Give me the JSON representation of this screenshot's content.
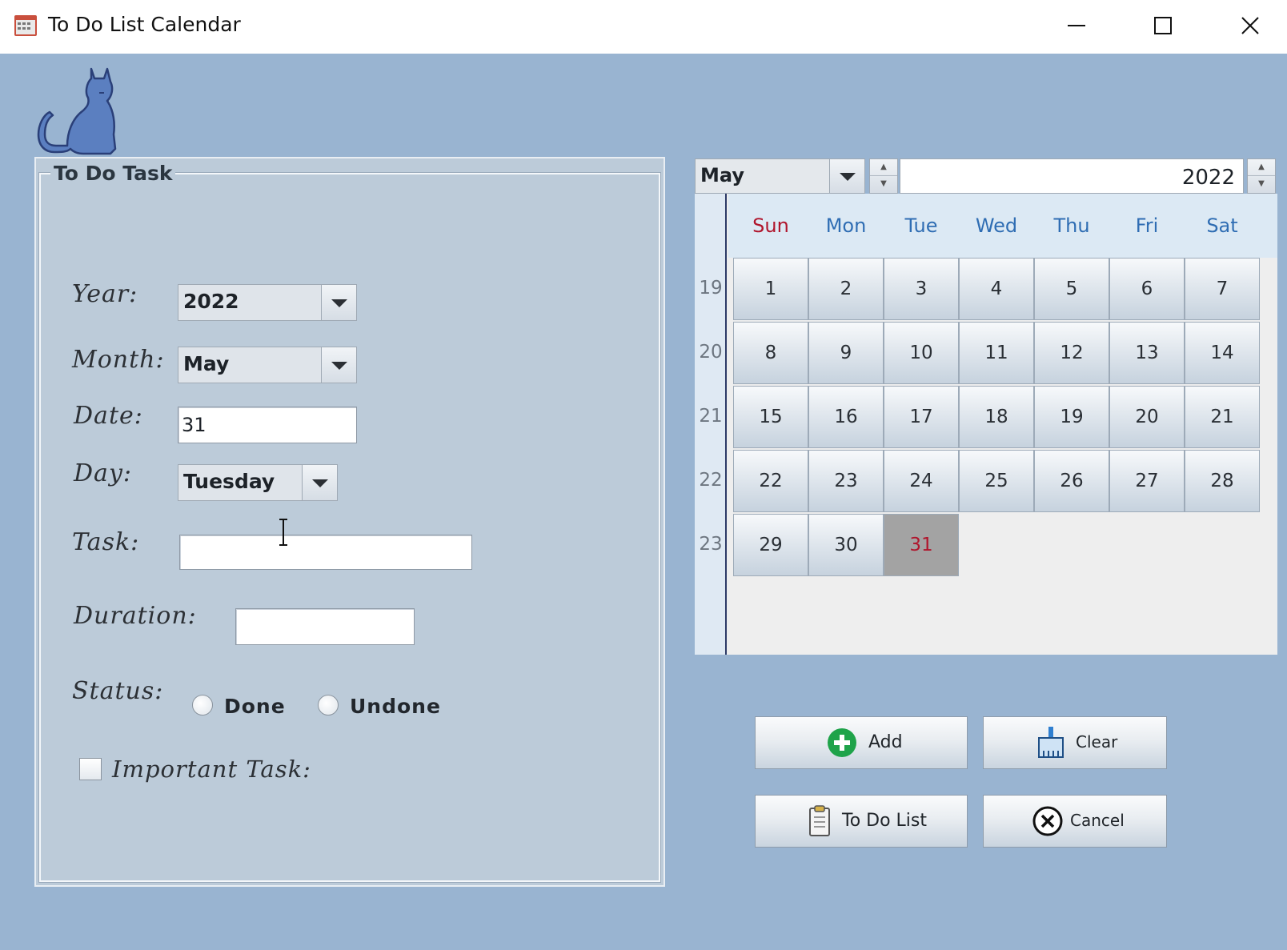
{
  "window": {
    "title": "To Do List Calendar",
    "app_icon": "calendar-app-icon",
    "controls": [
      "minimize-icon",
      "maximize-icon",
      "close-icon"
    ]
  },
  "logo": "cat-icon",
  "task_panel": {
    "title": "To Do Task",
    "year": {
      "label": "Year:",
      "value": "2022"
    },
    "month": {
      "label": "Month:",
      "value": "May"
    },
    "date": {
      "label": "Date:",
      "value": "31"
    },
    "day": {
      "label": "Day:",
      "value": "Tuesday"
    },
    "task": {
      "label": "Task:",
      "value": ""
    },
    "duration": {
      "label": "Duration:",
      "value": ""
    },
    "status": {
      "label": "Status:",
      "options": [
        "Done",
        "Undone"
      ],
      "selected": null
    },
    "important": {
      "label": "Important Task:",
      "checked": false
    }
  },
  "calendar": {
    "month": "May",
    "year": "2022",
    "days_of_week": [
      "Sun",
      "Mon",
      "Tue",
      "Wed",
      "Thu",
      "Fri",
      "Sat"
    ],
    "weeks": [
      {
        "week": "19",
        "days": [
          "1",
          "2",
          "3",
          "4",
          "5",
          "6",
          "7"
        ]
      },
      {
        "week": "20",
        "days": [
          "8",
          "9",
          "10",
          "11",
          "12",
          "13",
          "14"
        ]
      },
      {
        "week": "21",
        "days": [
          "15",
          "16",
          "17",
          "18",
          "19",
          "20",
          "21"
        ]
      },
      {
        "week": "22",
        "days": [
          "22",
          "23",
          "24",
          "25",
          "26",
          "27",
          "28"
        ]
      },
      {
        "week": "23",
        "days": [
          "29",
          "30",
          "31"
        ]
      }
    ],
    "selected_day": "31",
    "colors": {
      "weekday": "#2f6db3",
      "sunday": "#b0152c",
      "selected_bg": "#a3a3a3"
    }
  },
  "buttons": {
    "add": {
      "label": "Add",
      "icon": "add-icon"
    },
    "clear": {
      "label": "Clear",
      "icon": "broom-icon"
    },
    "todo_list": {
      "label": "To Do List",
      "icon": "clipboard-icon"
    },
    "cancel": {
      "label": "Cancel",
      "icon": "cancel-icon"
    }
  }
}
